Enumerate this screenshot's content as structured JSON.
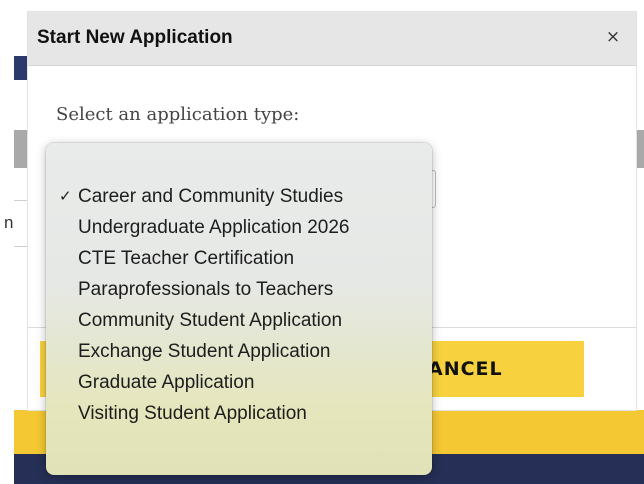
{
  "dialog": {
    "title": "Start New Application",
    "close_label": "×",
    "prompt": "Select an application type:",
    "cancel_label": "ANCEL"
  },
  "background": {
    "row_text": "n"
  },
  "dropdown": {
    "check_mark": "✓",
    "selected_value": "Career and Community Studies",
    "options": [
      "Career and Community Studies",
      "Undergraduate Application 2026",
      "CTE Teacher Certification",
      "Paraprofessionals to Teachers",
      "Community Student Application",
      "Exchange Student Application",
      "Graduate Application",
      "Visiting Student Application"
    ]
  },
  "colors": {
    "accent_gold": "#f7d23e",
    "navy": "#262f55",
    "header_gray": "#e6e6e6"
  },
  "icons": {
    "close": "close-icon",
    "selected": "check-icon"
  }
}
